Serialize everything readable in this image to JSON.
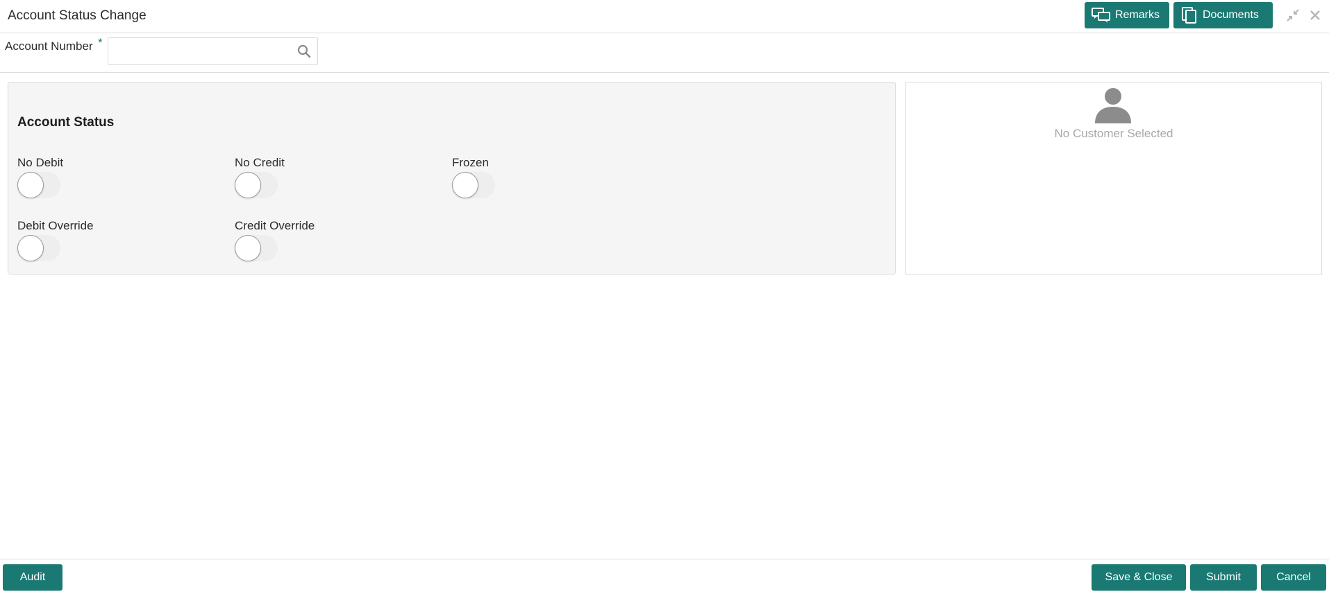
{
  "window": {
    "title": "Account Status Change",
    "remarks_label": "Remarks",
    "documents_label": "Documents"
  },
  "account": {
    "label": "Account Number",
    "required_mark": "*",
    "value": "",
    "placeholder": ""
  },
  "status": {
    "section_title": "Account Status",
    "toggles": [
      {
        "label": "No Debit",
        "on": false
      },
      {
        "label": "No Credit",
        "on": false
      },
      {
        "label": "Frozen",
        "on": false
      },
      {
        "label": "Debit Override",
        "on": false
      },
      {
        "label": "Credit Override",
        "on": false
      }
    ]
  },
  "customer": {
    "empty_text": "No Customer Selected"
  },
  "footer": {
    "audit_label": "Audit",
    "save_close_label": "Save & Close",
    "submit_label": "Submit",
    "cancel_label": "Cancel"
  },
  "colors": {
    "accent": "#1a7a73",
    "panel_bg": "#f5f5f5",
    "muted_text": "#a8a8a8"
  },
  "icons": {
    "remarks": "chat-bubbles-icon",
    "documents": "documents-icon",
    "minimize": "collapse-arrows-icon",
    "close": "close-icon",
    "search": "search-icon",
    "avatar": "user-silhouette-icon"
  }
}
